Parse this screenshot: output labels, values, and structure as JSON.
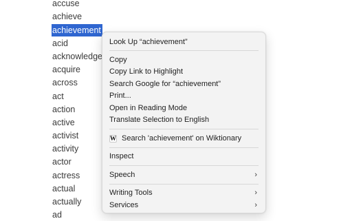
{
  "words": [
    {
      "text": "accuse",
      "selected": false
    },
    {
      "text": "achieve",
      "selected": false
    },
    {
      "text": "achievement",
      "selected": true
    },
    {
      "text": "acid",
      "selected": false
    },
    {
      "text": "acknowledge",
      "selected": false
    },
    {
      "text": "acquire",
      "selected": false
    },
    {
      "text": "across",
      "selected": false
    },
    {
      "text": "act",
      "selected": false
    },
    {
      "text": "action",
      "selected": false
    },
    {
      "text": "active",
      "selected": false
    },
    {
      "text": "activist",
      "selected": false
    },
    {
      "text": "activity",
      "selected": false
    },
    {
      "text": "actor",
      "selected": false
    },
    {
      "text": "actress",
      "selected": false
    },
    {
      "text": "actual",
      "selected": false
    },
    {
      "text": "actually",
      "selected": false
    },
    {
      "text": "ad",
      "selected": false
    }
  ],
  "menu": {
    "look_up": "Look Up “achievement”",
    "copy": "Copy",
    "copy_link": "Copy Link to Highlight",
    "search_google": "Search Google for “achievement”",
    "print": "Print...",
    "reading_mode": "Open in Reading Mode",
    "translate": "Translate Selection to English",
    "wiktionary": "Search 'achievement' on Wiktionary",
    "wiktionary_icon": "W",
    "inspect": "Inspect",
    "speech": "Speech",
    "writing_tools": "Writing Tools",
    "services": "Services",
    "submenu_chevron": "›"
  },
  "colors": {
    "selection": "#2f66d0",
    "menu_background": "#f3f3f3"
  }
}
